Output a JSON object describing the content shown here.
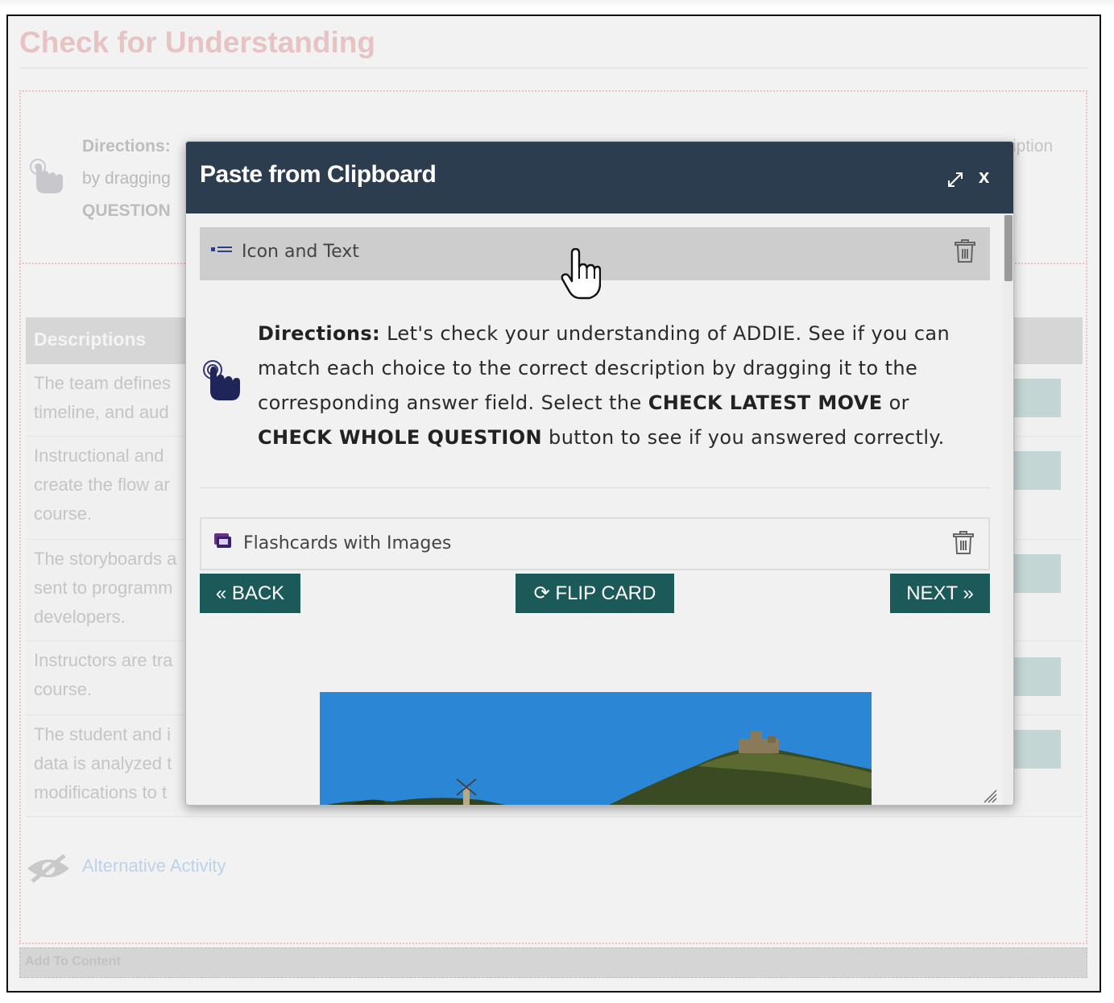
{
  "page": {
    "title": "Check for Understanding",
    "directions_label": "Directions:",
    "directions_line2": "by dragging",
    "directions_line3": "QUESTION",
    "directions_tail": "iption",
    "table_header": "Descriptions",
    "rows": [
      "The team defines\ntimeline, and aud",
      "Instructional and\ncreate the flow ar\ncourse.",
      "The storyboards a\nsent to programm\ndevelopers.",
      "Instructors are tra\ncourse.",
      "The student and i\ndata is analyzed t\nmodifications to t"
    ],
    "alternative_activity": "Alternative Activity",
    "add_to_content": "Add To Content"
  },
  "modal": {
    "title": "Paste from Clipboard",
    "close_label": "x",
    "icons": {
      "expand": "expand-icon",
      "close": "close-icon",
      "trash": "trash-icon",
      "list": "list-icon",
      "flashcards": "flashcards-icon",
      "pointer": "pointer-hand-icon",
      "flip": "refresh-icon"
    },
    "blocks": [
      {
        "label": "Icon and Text"
      },
      {
        "label": "Flashcards with Images"
      }
    ],
    "directions": {
      "bold_label": "Directions:",
      "text_1": " Let's check your understanding of ADDIE. See if you can match each choice to the correct description by dragging it to the corresponding answer field. Select the ",
      "bold_2": "CHECK LATEST MOVE",
      "text_2": " or ",
      "bold_3": "CHECK WHOLE QUESTION",
      "text_3": " button to see if you answered correctly."
    },
    "buttons": {
      "back": "« BACK",
      "flip": "FLIP CARD",
      "flip_glyph": "⟳",
      "next": "NEXT »"
    }
  },
  "colors": {
    "header": "#2d3d50",
    "button": "#1c5a5a",
    "title_dim": "#e7c3c3",
    "sky": "#2b86d6"
  }
}
